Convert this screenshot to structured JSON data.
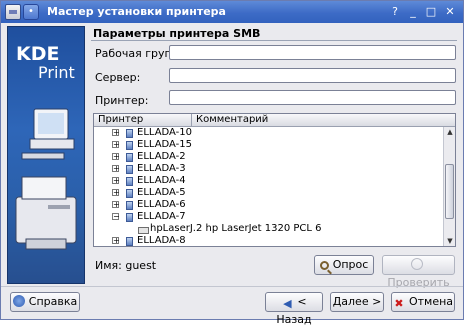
{
  "window": {
    "title": "Мастер установки принтера",
    "title_icons": [
      "app-icon",
      "pin-icon",
      "menu-icon"
    ],
    "controls": [
      "help-icon",
      "minimize-icon",
      "maximize-icon",
      "close-icon"
    ]
  },
  "sidebar": {
    "logo_kde": "KDE",
    "logo_print": "Print"
  },
  "page": {
    "heading": "Параметры принтера SMB",
    "workgroup_label": "Рабочая группа:",
    "workgroup_value": "",
    "server_label": "Сервер:",
    "server_value": "",
    "printer_label": "Принтер:",
    "printer_value": ""
  },
  "tree": {
    "columns": [
      "Принтер",
      "Комментарий"
    ],
    "rows": [
      {
        "label": "ELLADA-10",
        "expander": "+"
      },
      {
        "label": "ELLADA-15",
        "expander": "+"
      },
      {
        "label": "ELLADA-2",
        "expander": "+"
      },
      {
        "label": "ELLADA-3",
        "expander": "+"
      },
      {
        "label": "ELLADA-4",
        "expander": "+"
      },
      {
        "label": "ELLADA-5",
        "expander": "+"
      },
      {
        "label": "ELLADA-6",
        "expander": "+"
      },
      {
        "label": "ELLADA-7",
        "expander": "−"
      },
      {
        "label": "hpLaserJ.2 hp LaserJet 1320 PCL 6",
        "expander": ""
      },
      {
        "label": "ELLADA-8",
        "expander": "+"
      }
    ]
  },
  "name_label": "Имя: guest",
  "buttons": {
    "query": "Опрос",
    "browse": "Проверить",
    "help": "Справка",
    "back": "< Назад",
    "next": "Далее >",
    "cancel": "Отмена"
  },
  "colors": {
    "titlebar": "#3d6bc6",
    "sidebar": "#2e66b8",
    "cancel_icon": "#cc1b1b"
  }
}
